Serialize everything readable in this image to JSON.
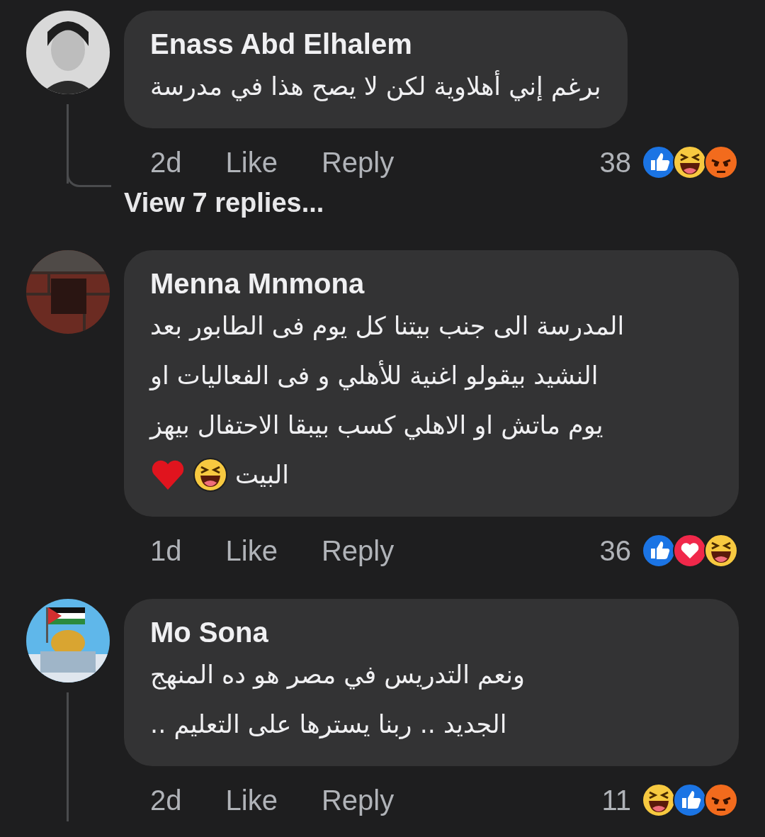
{
  "comments": [
    {
      "author": "Enass Abd Elhalem",
      "avatar": {
        "kind": "picture"
      },
      "lines": [
        "برغم إني أهلاوية لكن لا يصح هذا في مدرسة"
      ],
      "time": "2d",
      "like": "Like",
      "reply": "Reply",
      "reaction_count": "38",
      "reactions": [
        {
          "kind": "like"
        },
        {
          "kind": "haha"
        },
        {
          "kind": "angry"
        }
      ],
      "reply_thread": true,
      "replies_link": "View 7 replies..."
    },
    {
      "author": "Menna Mnmona",
      "avatar": {
        "kind": "picture"
      },
      "lines": [
        "المدرسة الى جنب بيتنا كل يوم فى الطابور بعد",
        "النشيد بيقولو اغنية للأهلي و فى الفعاليات او",
        "يوم ماتش او الاهلي كسب بيبقا الاحتفال بيهز",
        "البيت"
      ],
      "inline_emojis": [
        {
          "kind": "haha"
        },
        {
          "kind": "heart"
        }
      ],
      "time": "1d",
      "like": "Like",
      "reply": "Reply",
      "reaction_count": "36",
      "reactions": [
        {
          "kind": "like"
        },
        {
          "kind": "love"
        },
        {
          "kind": "haha"
        }
      ],
      "reply_thread": false
    },
    {
      "author": "Mo Sona",
      "avatar": {
        "kind": "picture"
      },
      "lines": [
        "ونعم التدريس في مصر  هو ده المنهج",
        "الجديد  .. ربنا يسترها على التعليم .."
      ],
      "time": "2d",
      "like": "Like",
      "reply": "Reply",
      "reaction_count": "11",
      "reactions": [
        {
          "kind": "haha"
        },
        {
          "kind": "like"
        },
        {
          "kind": "angry"
        }
      ],
      "reply_thread": true
    }
  ]
}
